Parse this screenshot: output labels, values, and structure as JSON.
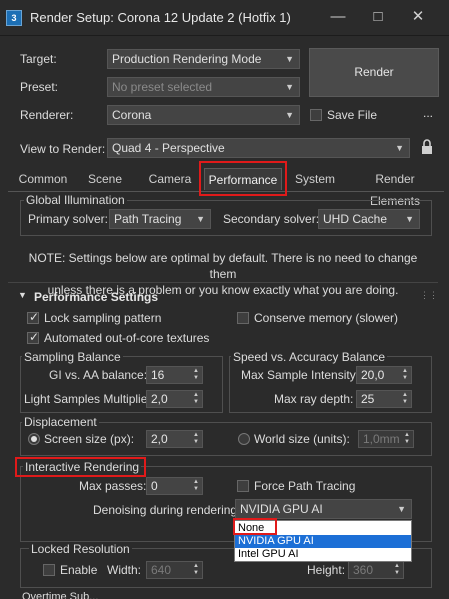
{
  "window": {
    "title": "Render Setup: Corona 12 Update 2 (Hotfix 1)",
    "app_icon": "3",
    "controls": [
      "minimize-icon",
      "maximize-icon",
      "close-icon"
    ]
  },
  "header": {
    "target_label": "Target:",
    "target_value": "Production Rendering Mode",
    "preset_label": "Preset:",
    "preset_value": "No preset selected",
    "renderer_label": "Renderer:",
    "renderer_value": "Corona",
    "save_file_label": "Save File",
    "save_file_checked": false,
    "more_label": "...",
    "view_label": "View to Render:",
    "view_value": "Quad 4 - Perspective",
    "render_button": "Render",
    "lock_icon": "lock-icon"
  },
  "tabs": [
    {
      "label": "Common",
      "active": false
    },
    {
      "label": "Scene",
      "active": false
    },
    {
      "label": "Camera",
      "active": false
    },
    {
      "label": "Performance",
      "active": true
    },
    {
      "label": "System",
      "active": false
    },
    {
      "label": "Render Elements",
      "active": false
    }
  ],
  "global_illumination": {
    "title": "Global Illumination",
    "primary_label": "Primary solver:",
    "primary_value": "Path Tracing",
    "secondary_label": "Secondary solver:",
    "secondary_value": "UHD Cache"
  },
  "note": {
    "line1": "NOTE: Settings below are optimal by default. There is no need to change them",
    "line2": "unless there is a problem or you know exactly what you are doing."
  },
  "performance": {
    "title": "Performance Settings",
    "lock_sampling": {
      "label": "Lock sampling pattern",
      "checked": true
    },
    "conserve_memory": {
      "label": "Conserve memory (slower)",
      "checked": false
    },
    "out_of_core": {
      "label": "Automated out-of-core textures",
      "checked": true
    }
  },
  "sampling_balance": {
    "title": "Sampling Balance",
    "gi_aa_label": "GI vs. AA balance:",
    "gi_aa_value": "16",
    "light_samples_label": "Light Samples Multiplier:",
    "light_samples_value": "2,0"
  },
  "speed_accuracy": {
    "title": "Speed vs. Accuracy Balance",
    "max_intensity_label": "Max Sample Intensity:",
    "max_intensity_value": "20,0",
    "max_ray_label": "Max ray depth:",
    "max_ray_value": "25"
  },
  "displacement": {
    "title": "Displacement",
    "screen_size_label": "Screen size (px):",
    "screen_size_value": "2,0",
    "screen_size_selected": true,
    "world_size_label": "World size (units):",
    "world_size_value": "1,0mm"
  },
  "interactive": {
    "title": "Interactive Rendering",
    "max_passes_label": "Max passes:",
    "max_passes_value": "0",
    "force_path_label": "Force Path Tracing",
    "force_path_checked": false,
    "denoising_label": "Denoising during rendering:",
    "denoising_value": "NVIDIA GPU AI",
    "denoising_options": [
      "None",
      "NVIDIA GPU AI",
      "Intel GPU AI"
    ],
    "denoising_highlighted": "NVIDIA GPU AI"
  },
  "locked_resolution": {
    "title": "Locked Resolution",
    "enable_label": "Enable",
    "enable_checked": false,
    "width_label": "Width:",
    "width_value": "640",
    "height_label": "Height:",
    "height_value": "360"
  },
  "bottom_partial": "Overtime Sub...",
  "colors": {
    "background": "#2b2b2b",
    "highlight_red": "#e01a1a",
    "selection_blue": "#1c6fd6"
  }
}
